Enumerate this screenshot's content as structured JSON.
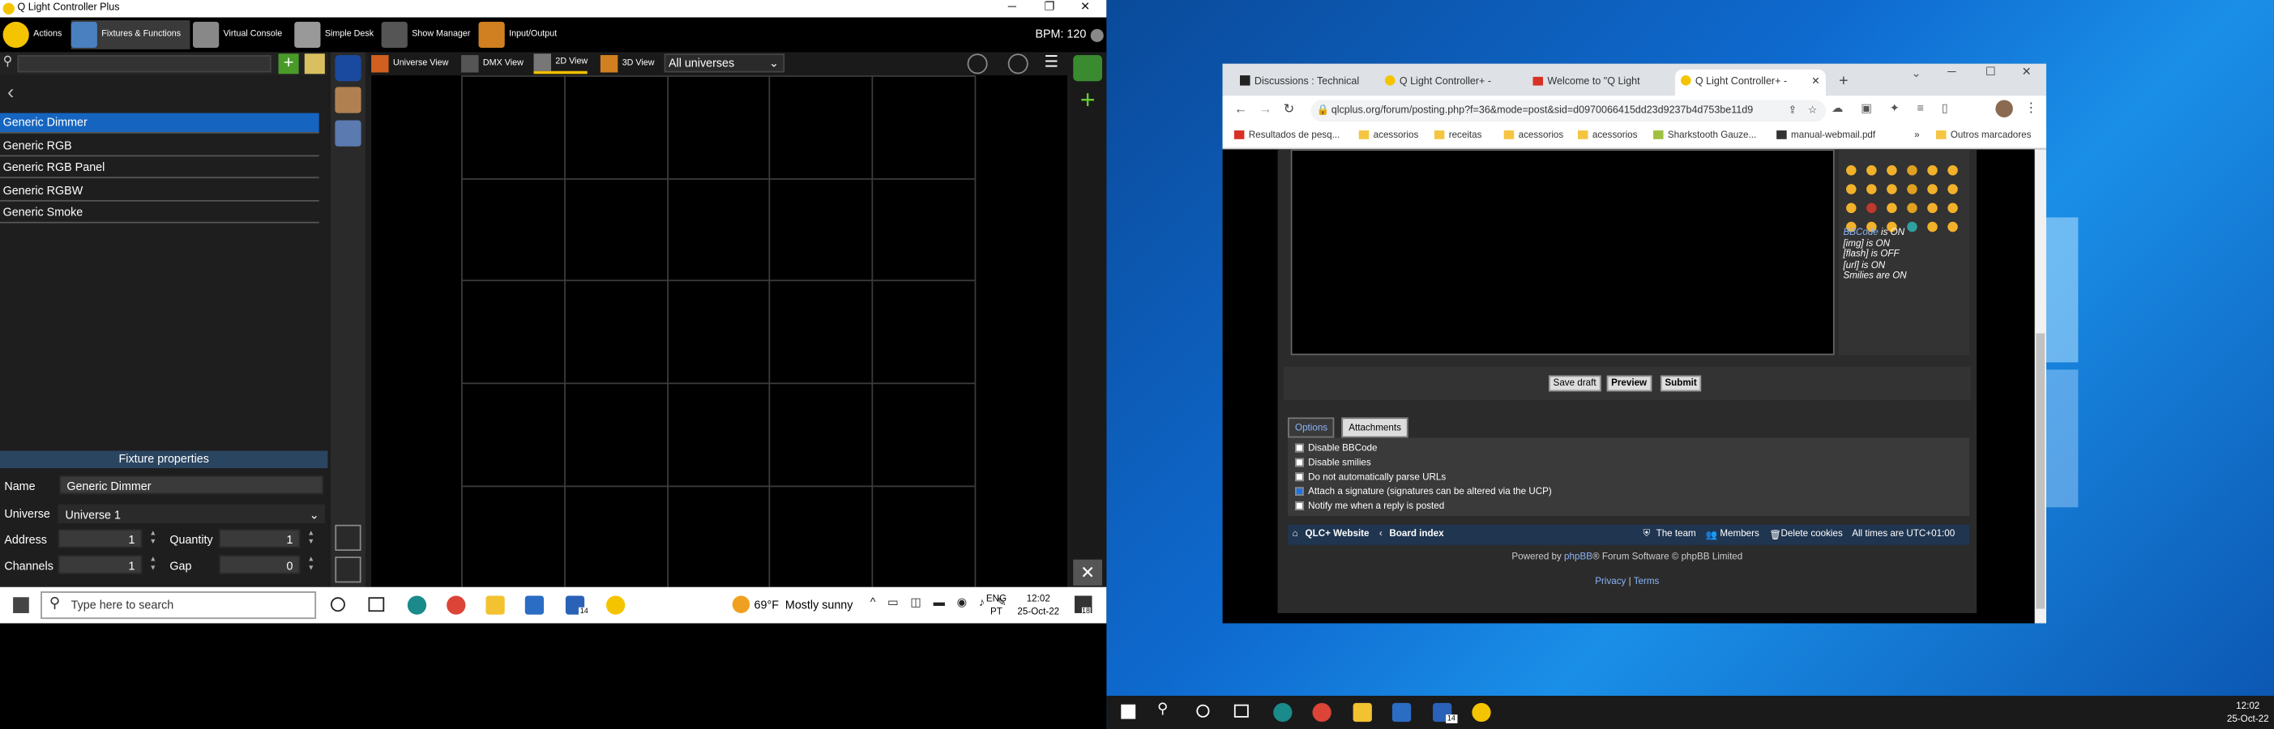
{
  "qlc": {
    "window_title": "Q Light Controller Plus",
    "toolbar": {
      "actions": "Actions",
      "fixtures_functions": "Fixtures & Functions",
      "virtual_console": "Virtual Console",
      "simple_desk": "Simple Desk",
      "show_manager": "Show Manager",
      "input_output": "Input/Output",
      "bpm": "BPM: 120"
    },
    "fixtures": [
      "Generic Dimmer",
      "Generic RGB",
      "Generic RGB Panel",
      "Generic RGBW",
      "Generic Smoke"
    ],
    "view_tabs": {
      "universe_view": "Universe View",
      "dmx_view": "DMX View",
      "view_2d": "2D View",
      "view_3d": "3D View",
      "universe_select": "All universes"
    },
    "properties": {
      "header": "Fixture properties",
      "name_label": "Name",
      "name_value": "Generic Dimmer",
      "universe_label": "Universe",
      "universe_value": "Universe 1",
      "address_label": "Address",
      "address_value": "1",
      "quantity_label": "Quantity",
      "quantity_value": "1",
      "channels_label": "Channels",
      "channels_value": "1",
      "gap_label": "Gap",
      "gap_value": "0"
    }
  },
  "taskbar_left": {
    "search_placeholder": "Type here to search",
    "weather": "69°F  Mostly sunny",
    "lang": "ENG",
    "lang2": "PT",
    "time": "12:02",
    "date": "25-Oct-22",
    "mail_badge": "14",
    "notif_badge": "18"
  },
  "browser": {
    "tabs": [
      "Discussions : Technical",
      "Q Light Controller+ - ",
      "Welcome to \"Q Light",
      "Q Light Controller+ - "
    ],
    "url": "qlcplus.org/forum/posting.php?f=36&mode=post&sid=d0970066415dd23d9237b4d753be11d9",
    "bookmarks": [
      "Resultados de pesq...",
      "acessorios",
      "receitas",
      "acessorios",
      "acessorios",
      "Sharkstooth Gauze...",
      "manual-webmail.pdf",
      "Outros marcadores"
    ],
    "bbcode": {
      "bbcode_link": "BBCode",
      "bbcode_state": " is ON",
      "img": "[img] is ON",
      "flash": "[flash] is OFF",
      "url": "[url] is ON",
      "smilies": "Smilies are ON"
    },
    "buttons": {
      "save_draft": "Save draft",
      "preview": "Preview",
      "submit": "Submit"
    },
    "option_tabs": {
      "options": "Options",
      "attachments": "Attachments"
    },
    "options": [
      {
        "label": "Disable BBCode",
        "checked": false
      },
      {
        "label": "Disable smilies",
        "checked": false
      },
      {
        "label": "Do not automatically parse URLs",
        "checked": false
      },
      {
        "label": "Attach a signature (signatures can be altered via the UCP)",
        "checked": true
      },
      {
        "label": "Notify me when a reply is posted",
        "checked": false
      }
    ],
    "footer": {
      "website": "QLC+ Website",
      "board_index": "Board index",
      "team": "The team",
      "members": "Members",
      "delete_cookies": "Delete cookies",
      "timezone": "All times are UTC+01:00",
      "powered_by_pre": "Powered by ",
      "phpbb": "phpBB",
      "powered_by_post": "® Forum Software © phpBB Limited",
      "privacy": "Privacy",
      "sep": "|",
      "terms": "Terms"
    }
  },
  "taskbar_right": {
    "time": "12:02",
    "date": "25-Oct-22",
    "mail_badge": "14"
  },
  "colors": {
    "accent_blue": "#0a6fd6",
    "selected_row": "#1565c0"
  }
}
